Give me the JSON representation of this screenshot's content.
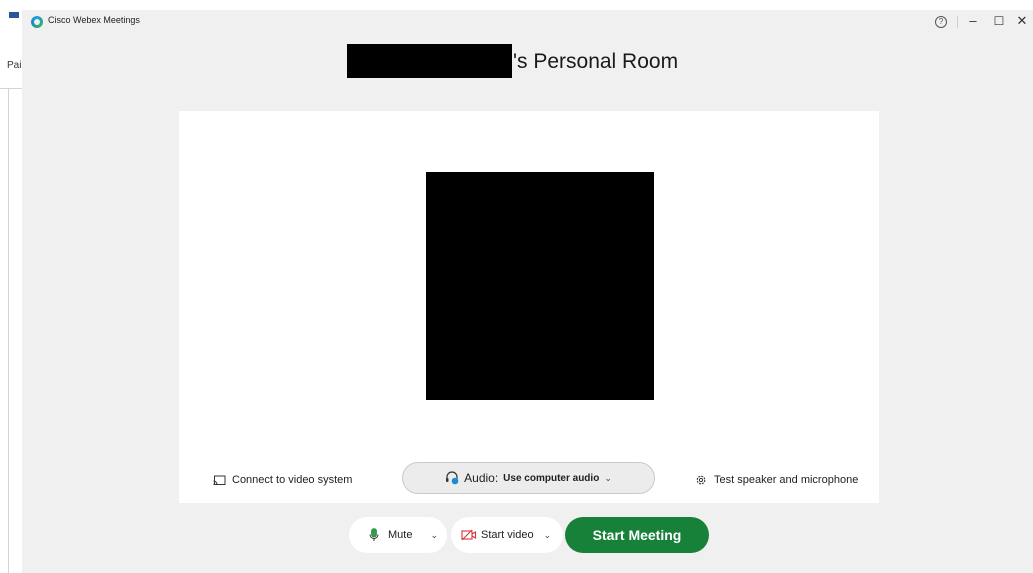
{
  "background_app": {
    "partial_text": "Pai"
  },
  "window": {
    "app_title": "Cisco Webex Meetings",
    "controls": {
      "help_icon": "question-circle-icon",
      "help_glyph": "?",
      "minimize": "–",
      "maximize": "☐",
      "close": "✕"
    }
  },
  "room": {
    "title": "'s Personal Room",
    "name_redacted": true,
    "avatar_redacted": true
  },
  "options": {
    "connect_label": "Connect to video system",
    "audio_prefix": "Audio:",
    "audio_value": "Use computer audio",
    "audio_chevron": "⌄",
    "test_label": "Test speaker and microphone"
  },
  "controls": {
    "mute_label": "Mute",
    "mute_chevron": "⌄",
    "video_label": "Start video",
    "video_chevron": "⌄",
    "start_label": "Start Meeting"
  },
  "colors": {
    "accent_green": "#17813a",
    "mic_green": "#2e9e49",
    "video_red": "#d6333a",
    "audio_blue": "#1a8fd0"
  }
}
